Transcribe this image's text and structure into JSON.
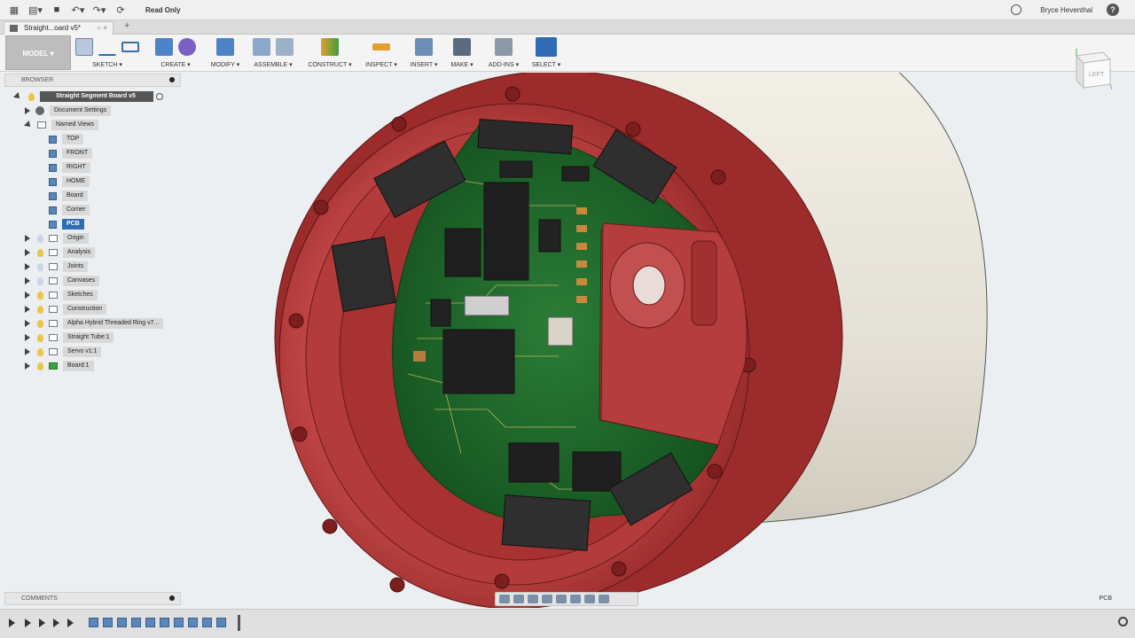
{
  "titlebar": {
    "read_only": "Read Only",
    "user": "Bryce Heventhal",
    "help": "?"
  },
  "tab": {
    "title": "Straight...oard v5*",
    "close": "○ ×",
    "new_tab": "+"
  },
  "toolbar": {
    "workspace": "MODEL ▾",
    "groups": [
      {
        "label": "SKETCH ▾"
      },
      {
        "label": "CREATE ▾"
      },
      {
        "label": "MODIFY ▾"
      },
      {
        "label": "ASSEMBLE ▾"
      },
      {
        "label": "CONSTRUCT ▾"
      },
      {
        "label": "INSPECT ▾"
      },
      {
        "label": "INSERT ▾"
      },
      {
        "label": "MAKE ▾"
      },
      {
        "label": "ADD-INS ▾"
      },
      {
        "label": "SELECT ▾"
      }
    ]
  },
  "browser": {
    "header": "BROWSER",
    "root": "Straight Segment Board v5",
    "document_settings": "Document Settings",
    "named_views": "Named Views",
    "views": [
      "TOP",
      "FRONT",
      "RIGHT",
      "HOME",
      "Board",
      "Corner",
      "PCB"
    ],
    "items": [
      "Origin",
      "Analysis",
      "Joints",
      "Canvases",
      "Sketches",
      "Construction",
      "Alpha Hybrid Threaded Ring v7...",
      "Straight Tube:1",
      "Servo v1:1",
      "Board:1"
    ]
  },
  "comments": {
    "header": "COMMENTS"
  },
  "status": {
    "view_name": "PCB"
  },
  "viewcube": {
    "face": "LEFT"
  },
  "colors": {
    "tube_red": "#b83a3a",
    "pcb_green": "#1e6b2c",
    "tube_body": "#e6e2d8",
    "selected_blue": "#2f6cb5"
  }
}
